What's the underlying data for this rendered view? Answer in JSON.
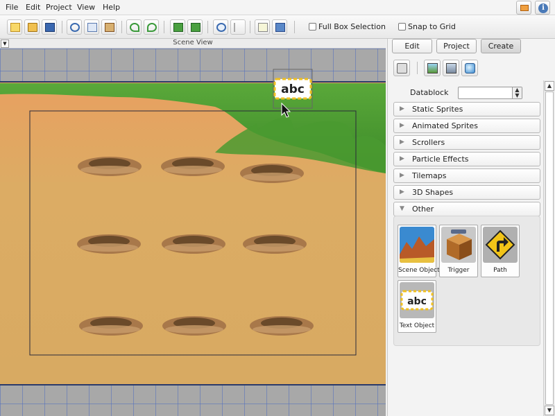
{
  "menu": {
    "items": [
      {
        "id": "file",
        "label": "File"
      },
      {
        "id": "edit",
        "label": "Edit"
      },
      {
        "id": "project",
        "label": "Project"
      },
      {
        "id": "view",
        "label": "View"
      },
      {
        "id": "help",
        "label": "Help"
      }
    ]
  },
  "toolbar": {
    "buttons": [
      {
        "name": "new-scene-button",
        "icon": "new-file-icon"
      },
      {
        "name": "open-button",
        "icon": "open-folder-icon"
      },
      {
        "name": "save-button",
        "icon": "save-disk-icon"
      },
      {
        "name": "cut-button",
        "icon": "scissors-icon"
      },
      {
        "name": "copy-button",
        "icon": "copy-icon"
      },
      {
        "name": "paste-button",
        "icon": "paste-icon"
      },
      {
        "name": "undo-button",
        "icon": "undo-icon"
      },
      {
        "name": "redo-button",
        "icon": "redo-icon"
      },
      {
        "name": "bring-forward-button",
        "icon": "layer-up-icon"
      },
      {
        "name": "send-backward-button",
        "icon": "layer-down-icon"
      },
      {
        "name": "play-button",
        "icon": "play-icon"
      },
      {
        "name": "select-tool-button",
        "icon": "cursor-icon"
      },
      {
        "name": "edit-object-button",
        "icon": "edit-icon"
      },
      {
        "name": "screen-settings-button",
        "icon": "screen-icon"
      }
    ],
    "full_box_selection_label": "Full Box Selection",
    "snap_to_grid_label": "Snap to Grid",
    "full_box_selection_checked": false,
    "snap_to_grid_checked": false
  },
  "scene": {
    "title": "Scene View",
    "placed_text_object": "abc",
    "colors": {
      "background": "#a8a8a8",
      "grid": "#506ebe",
      "sand": "#dcaa60",
      "grass": "#58a038",
      "dirt": "#a8784a"
    },
    "dirt_mounds": 9
  },
  "panel": {
    "tabs": [
      {
        "id": "edit",
        "label": "Edit",
        "active": false
      },
      {
        "id": "project",
        "label": "Project",
        "active": false
      },
      {
        "id": "create",
        "label": "Create",
        "active": true
      }
    ],
    "datablock": {
      "label": "Datablock",
      "value": ""
    },
    "categories": [
      {
        "label": "Static Sprites",
        "expanded": false
      },
      {
        "label": "Animated Sprites",
        "expanded": false
      },
      {
        "label": "Scrollers",
        "expanded": false
      },
      {
        "label": "Particle Effects",
        "expanded": false
      },
      {
        "label": "Tilemaps",
        "expanded": false
      },
      {
        "label": "3D Shapes",
        "expanded": false
      },
      {
        "label": "Other",
        "expanded": true
      }
    ],
    "other_objects": [
      {
        "label": "Scene Object",
        "icon": "scene-object-icon"
      },
      {
        "label": "Trigger",
        "icon": "trigger-icon"
      },
      {
        "label": "Path",
        "icon": "path-sign-icon"
      },
      {
        "label": "Text Object",
        "icon": "text-object-icon"
      }
    ]
  }
}
